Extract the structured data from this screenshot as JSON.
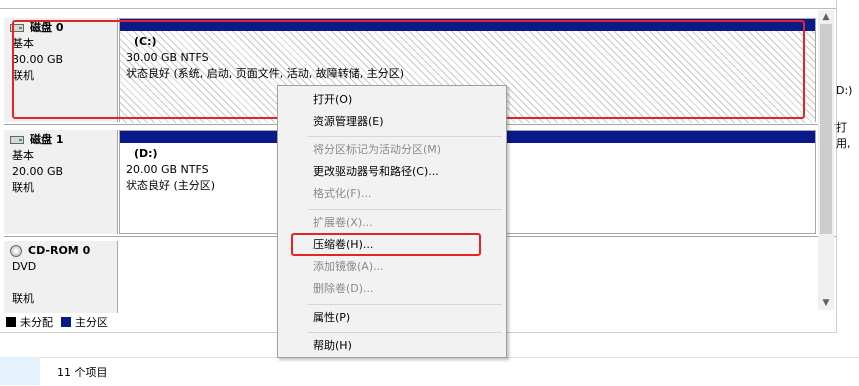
{
  "disks": [
    {
      "title": "磁盘 0",
      "type": "基本",
      "size": "30.00 GB",
      "status": "联机",
      "volume": {
        "name": "(C:)",
        "size": "30.00 GB NTFS",
        "status": "状态良好 (系统, 启动, 页面文件, 活动, 故障转储, 主分区)"
      }
    },
    {
      "title": "磁盘 1",
      "type": "基本",
      "size": "20.00 GB",
      "status": "联机",
      "volume": {
        "name": "(D:)",
        "size": "20.00 GB NTFS",
        "status": "状态良好 (主分区)"
      }
    },
    {
      "title": "CD-ROM 0",
      "type": "DVD",
      "status": "联机"
    }
  ],
  "legend": {
    "unallocated": "未分配",
    "primary": "主分区",
    "colors": {
      "unallocated": "#000000",
      "primary": "#0a1a8a"
    }
  },
  "context_menu": {
    "items": [
      {
        "label": "打开(O)",
        "enabled": true
      },
      {
        "label": "资源管理器(E)",
        "enabled": true
      },
      {
        "label": "将分区标记为活动分区(M)",
        "enabled": false
      },
      {
        "label": "更改驱动器号和路径(C)...",
        "enabled": true
      },
      {
        "label": "格式化(F)...",
        "enabled": false
      },
      {
        "label": "扩展卷(X)...",
        "enabled": false
      },
      {
        "label": "压缩卷(H)...",
        "enabled": true
      },
      {
        "label": "添加镜像(A)...",
        "enabled": false
      },
      {
        "label": "删除卷(D)...",
        "enabled": false
      },
      {
        "label": "属性(P)",
        "enabled": true
      },
      {
        "label": "帮助(H)",
        "enabled": true
      }
    ]
  },
  "status_bar": {
    "item_count": "11 个项目"
  },
  "right_panel": {
    "fragment_a": "D:)",
    "fragment_b": "打用,"
  },
  "highlight_color": "#e52424"
}
